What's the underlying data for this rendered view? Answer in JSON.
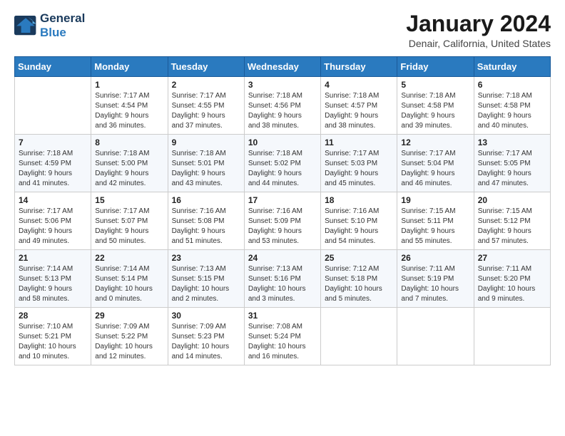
{
  "header": {
    "logo_line1": "General",
    "logo_line2": "Blue",
    "month": "January 2024",
    "location": "Denair, California, United States"
  },
  "weekdays": [
    "Sunday",
    "Monday",
    "Tuesday",
    "Wednesday",
    "Thursday",
    "Friday",
    "Saturday"
  ],
  "weeks": [
    [
      {
        "day": "",
        "info": ""
      },
      {
        "day": "1",
        "info": "Sunrise: 7:17 AM\nSunset: 4:54 PM\nDaylight: 9 hours\nand 36 minutes."
      },
      {
        "day": "2",
        "info": "Sunrise: 7:17 AM\nSunset: 4:55 PM\nDaylight: 9 hours\nand 37 minutes."
      },
      {
        "day": "3",
        "info": "Sunrise: 7:18 AM\nSunset: 4:56 PM\nDaylight: 9 hours\nand 38 minutes."
      },
      {
        "day": "4",
        "info": "Sunrise: 7:18 AM\nSunset: 4:57 PM\nDaylight: 9 hours\nand 38 minutes."
      },
      {
        "day": "5",
        "info": "Sunrise: 7:18 AM\nSunset: 4:58 PM\nDaylight: 9 hours\nand 39 minutes."
      },
      {
        "day": "6",
        "info": "Sunrise: 7:18 AM\nSunset: 4:58 PM\nDaylight: 9 hours\nand 40 minutes."
      }
    ],
    [
      {
        "day": "7",
        "info": "Sunrise: 7:18 AM\nSunset: 4:59 PM\nDaylight: 9 hours\nand 41 minutes."
      },
      {
        "day": "8",
        "info": "Sunrise: 7:18 AM\nSunset: 5:00 PM\nDaylight: 9 hours\nand 42 minutes."
      },
      {
        "day": "9",
        "info": "Sunrise: 7:18 AM\nSunset: 5:01 PM\nDaylight: 9 hours\nand 43 minutes."
      },
      {
        "day": "10",
        "info": "Sunrise: 7:18 AM\nSunset: 5:02 PM\nDaylight: 9 hours\nand 44 minutes."
      },
      {
        "day": "11",
        "info": "Sunrise: 7:17 AM\nSunset: 5:03 PM\nDaylight: 9 hours\nand 45 minutes."
      },
      {
        "day": "12",
        "info": "Sunrise: 7:17 AM\nSunset: 5:04 PM\nDaylight: 9 hours\nand 46 minutes."
      },
      {
        "day": "13",
        "info": "Sunrise: 7:17 AM\nSunset: 5:05 PM\nDaylight: 9 hours\nand 47 minutes."
      }
    ],
    [
      {
        "day": "14",
        "info": "Sunrise: 7:17 AM\nSunset: 5:06 PM\nDaylight: 9 hours\nand 49 minutes."
      },
      {
        "day": "15",
        "info": "Sunrise: 7:17 AM\nSunset: 5:07 PM\nDaylight: 9 hours\nand 50 minutes."
      },
      {
        "day": "16",
        "info": "Sunrise: 7:16 AM\nSunset: 5:08 PM\nDaylight: 9 hours\nand 51 minutes."
      },
      {
        "day": "17",
        "info": "Sunrise: 7:16 AM\nSunset: 5:09 PM\nDaylight: 9 hours\nand 53 minutes."
      },
      {
        "day": "18",
        "info": "Sunrise: 7:16 AM\nSunset: 5:10 PM\nDaylight: 9 hours\nand 54 minutes."
      },
      {
        "day": "19",
        "info": "Sunrise: 7:15 AM\nSunset: 5:11 PM\nDaylight: 9 hours\nand 55 minutes."
      },
      {
        "day": "20",
        "info": "Sunrise: 7:15 AM\nSunset: 5:12 PM\nDaylight: 9 hours\nand 57 minutes."
      }
    ],
    [
      {
        "day": "21",
        "info": "Sunrise: 7:14 AM\nSunset: 5:13 PM\nDaylight: 9 hours\nand 58 minutes."
      },
      {
        "day": "22",
        "info": "Sunrise: 7:14 AM\nSunset: 5:14 PM\nDaylight: 10 hours\nand 0 minutes."
      },
      {
        "day": "23",
        "info": "Sunrise: 7:13 AM\nSunset: 5:15 PM\nDaylight: 10 hours\nand 2 minutes."
      },
      {
        "day": "24",
        "info": "Sunrise: 7:13 AM\nSunset: 5:16 PM\nDaylight: 10 hours\nand 3 minutes."
      },
      {
        "day": "25",
        "info": "Sunrise: 7:12 AM\nSunset: 5:18 PM\nDaylight: 10 hours\nand 5 minutes."
      },
      {
        "day": "26",
        "info": "Sunrise: 7:11 AM\nSunset: 5:19 PM\nDaylight: 10 hours\nand 7 minutes."
      },
      {
        "day": "27",
        "info": "Sunrise: 7:11 AM\nSunset: 5:20 PM\nDaylight: 10 hours\nand 9 minutes."
      }
    ],
    [
      {
        "day": "28",
        "info": "Sunrise: 7:10 AM\nSunset: 5:21 PM\nDaylight: 10 hours\nand 10 minutes."
      },
      {
        "day": "29",
        "info": "Sunrise: 7:09 AM\nSunset: 5:22 PM\nDaylight: 10 hours\nand 12 minutes."
      },
      {
        "day": "30",
        "info": "Sunrise: 7:09 AM\nSunset: 5:23 PM\nDaylight: 10 hours\nand 14 minutes."
      },
      {
        "day": "31",
        "info": "Sunrise: 7:08 AM\nSunset: 5:24 PM\nDaylight: 10 hours\nand 16 minutes."
      },
      {
        "day": "",
        "info": ""
      },
      {
        "day": "",
        "info": ""
      },
      {
        "day": "",
        "info": ""
      }
    ]
  ]
}
